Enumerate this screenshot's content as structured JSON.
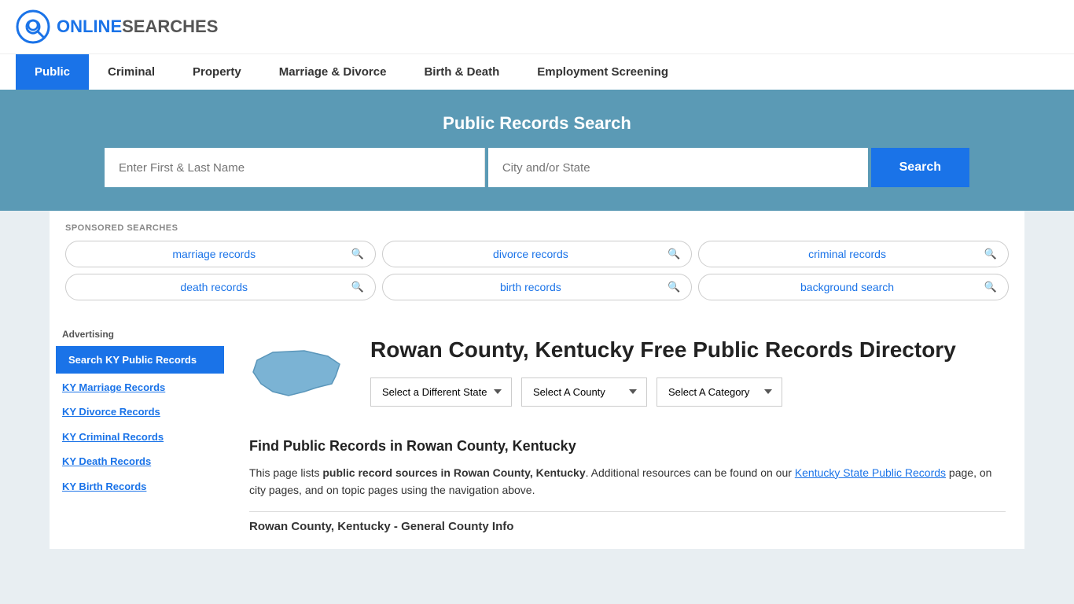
{
  "header": {
    "logo_online": "ONLINE",
    "logo_searches": "SEARCHES"
  },
  "nav": {
    "items": [
      {
        "label": "Public",
        "active": true
      },
      {
        "label": "Criminal",
        "active": false
      },
      {
        "label": "Property",
        "active": false
      },
      {
        "label": "Marriage & Divorce",
        "active": false
      },
      {
        "label": "Birth & Death",
        "active": false
      },
      {
        "label": "Employment Screening",
        "active": false
      }
    ]
  },
  "hero": {
    "title": "Public Records Search",
    "name_placeholder": "Enter First & Last Name",
    "location_placeholder": "City and/or State",
    "search_button": "Search"
  },
  "sponsored": {
    "label": "SPONSORED SEARCHES",
    "pills": [
      {
        "text": "marriage records"
      },
      {
        "text": "divorce records"
      },
      {
        "text": "criminal records"
      },
      {
        "text": "death records"
      },
      {
        "text": "birth records"
      },
      {
        "text": "background search"
      }
    ]
  },
  "page": {
    "title": "Rowan County, Kentucky Free Public Records Directory",
    "dropdowns": {
      "state": "Select a Different State",
      "county": "Select A County",
      "category": "Select A Category"
    },
    "find_title": "Find Public Records in Rowan County, Kentucky",
    "find_description_start": "This page lists ",
    "find_description_bold": "public record sources in Rowan County, Kentucky",
    "find_description_middle": ". Additional resources can be found on our ",
    "find_description_link": "Kentucky State Public Records",
    "find_description_end": " page, on city pages, and on topic pages using the navigation above.",
    "general_info_title": "Rowan County, Kentucky - General County Info"
  },
  "sidebar": {
    "ad_label": "Advertising",
    "ad_item": "Search KY Public Records",
    "links": [
      "KY Marriage Records",
      "KY Divorce Records",
      "KY Criminal Records",
      "KY Death Records",
      "KY Birth Records"
    ]
  }
}
